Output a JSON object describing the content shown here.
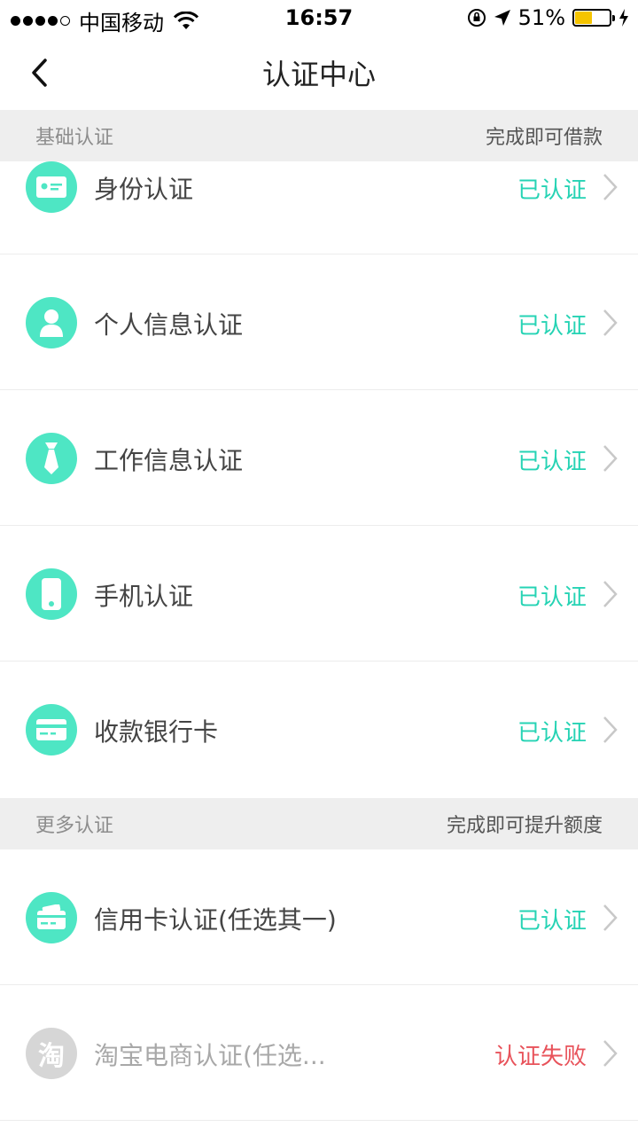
{
  "status_bar": {
    "carrier": "中国移动",
    "time": "16:57",
    "battery": "51%"
  },
  "nav": {
    "title": "认证中心"
  },
  "sections": [
    {
      "title": "基础认证",
      "subtitle": "完成即可借款",
      "items": [
        {
          "label": "身份认证",
          "status": "已认证",
          "icon": "id-card-icon"
        },
        {
          "label": "个人信息认证",
          "status": "已认证",
          "icon": "person-icon"
        },
        {
          "label": "工作信息认证",
          "status": "已认证",
          "icon": "tie-icon"
        },
        {
          "label": "手机认证",
          "status": "已认证",
          "icon": "phone-icon"
        },
        {
          "label": "收款银行卡",
          "status": "已认证",
          "icon": "bank-card-icon"
        }
      ]
    },
    {
      "title": "更多认证",
      "subtitle": "完成即可提升额度",
      "items": [
        {
          "label": "信用卡认证(任选其一)",
          "status": "已认证",
          "icon": "credit-card-icon"
        },
        {
          "label": "淘宝电商认证(任选...",
          "status": "认证失败",
          "icon": "taobao-icon",
          "icon_text": "淘"
        }
      ]
    }
  ],
  "colors": {
    "accent": "#4ee6c4",
    "verified": "#26d3b4",
    "failed": "#e8535b",
    "section_bg": "#eeeeee"
  }
}
